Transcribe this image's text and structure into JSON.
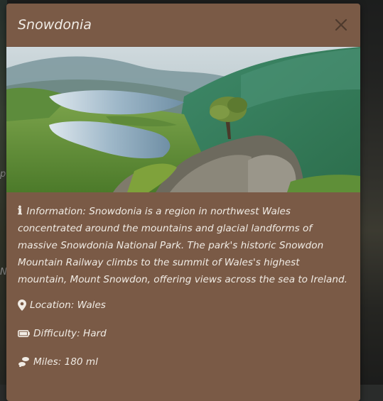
{
  "modal": {
    "title": "Snowdonia",
    "close_label": "×",
    "image_alt": "Snowdonia landscape",
    "info_label": "Information:",
    "info_text": "Snowdonia is a region in northwest Wales concentrated around the mountains and glacial landforms of massive Snowdonia National Park. The park's historic Snowdon Mountain Railway climbs to the summit of Wales's highest mountain, Mount Snowdon, offering views across the sea to Ireland.",
    "location": "Location: Wales",
    "difficulty": "Difficulty: Hard",
    "miles": "Miles: 180 ml"
  },
  "background": {
    "left_fragment_1": "p",
    "left_fragment_2": "N"
  },
  "colors": {
    "modal_bg": "#7a5a46",
    "text": "#f0ebe4",
    "close_icon": "#4e3a2d"
  },
  "icons": [
    "info-icon",
    "close-icon",
    "map-marker-icon",
    "battery-icon",
    "footprints-icon"
  ]
}
